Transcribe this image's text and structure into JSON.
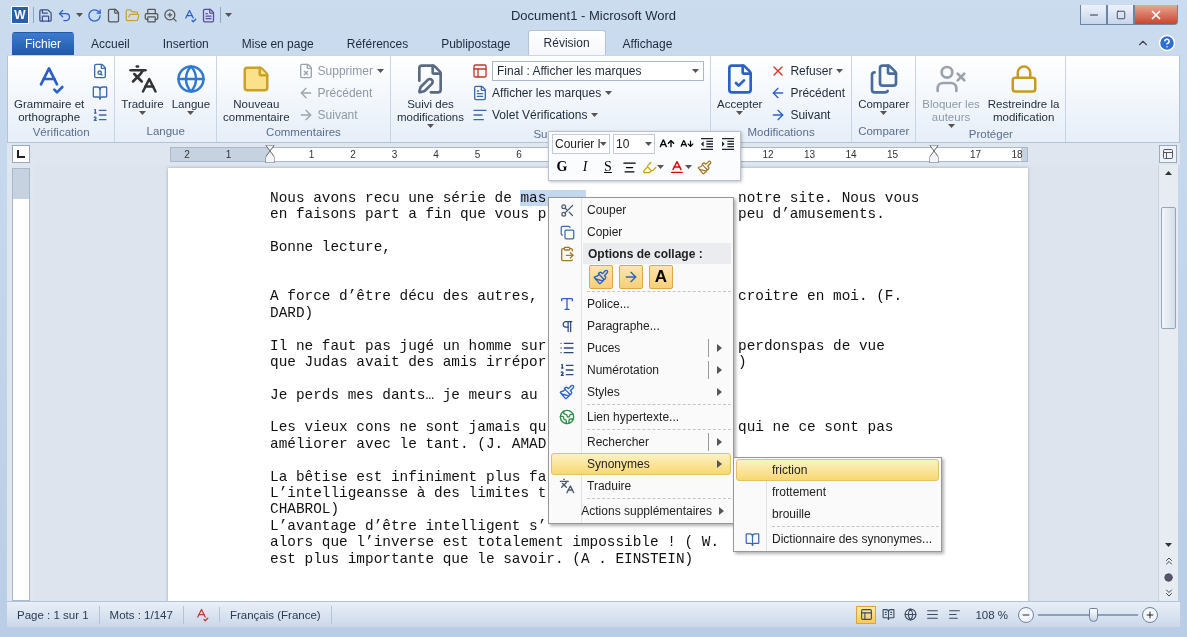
{
  "window": {
    "app_logo": "W",
    "title": "Document1 - Microsoft Word"
  },
  "tabs": [
    {
      "label": "Fichier",
      "kind": "file",
      "selected": false
    },
    {
      "label": "Accueil",
      "kind": "tab",
      "selected": false
    },
    {
      "label": "Insertion",
      "kind": "tab",
      "selected": false
    },
    {
      "label": "Mise en page",
      "kind": "tab",
      "selected": false
    },
    {
      "label": "Références",
      "kind": "tab",
      "selected": false
    },
    {
      "label": "Publipostage",
      "kind": "tab",
      "selected": false
    },
    {
      "label": "Révision",
      "kind": "tab",
      "selected": true
    },
    {
      "label": "Affichage",
      "kind": "tab",
      "selected": false
    }
  ],
  "ribbon": [
    {
      "label": "Vérification",
      "large": [
        {
          "lines": [
            "Grammaire et",
            "orthographe"
          ],
          "dropdown": false,
          "disabled": false
        }
      ],
      "small": [
        {
          "kind": "icon",
          "dropdown": false
        },
        {
          "kind": "icon",
          "dropdown": false
        },
        {
          "kind": "icon",
          "dropdown": false
        }
      ]
    },
    {
      "label": "Langue",
      "large": [
        {
          "lines": [
            "Traduire"
          ],
          "dropdown": true,
          "disabled": false
        },
        {
          "lines": [
            "Langue"
          ],
          "dropdown": true,
          "disabled": false
        }
      ]
    },
    {
      "label": "Commentaires",
      "large": [
        {
          "lines": [
            "Nouveau",
            "commentaire"
          ],
          "dropdown": false,
          "disabled": false
        }
      ],
      "small": [
        {
          "kind": "button",
          "label": "Supprimer",
          "dropdown": true,
          "disabled": true
        },
        {
          "kind": "button",
          "label": "Précédent",
          "dropdown": false,
          "disabled": true
        },
        {
          "kind": "button",
          "label": "Suivant",
          "dropdown": false,
          "disabled": true
        }
      ]
    },
    {
      "label": "Su",
      "large": [
        {
          "lines": [
            "Suivi des",
            "modifications"
          ],
          "dropdown": true,
          "disabled": false
        }
      ],
      "small": [
        {
          "kind": "combo",
          "label": "Final : Afficher les marques",
          "dropdown": true,
          "disabled": false
        },
        {
          "kind": "button",
          "label": "Afficher les marques",
          "dropdown": true,
          "disabled": false
        },
        {
          "kind": "button",
          "label": "Volet Vérifications",
          "dropdown": true,
          "disabled": false
        }
      ]
    },
    {
      "label": "Modifications",
      "large": [
        {
          "lines": [
            "Accepter"
          ],
          "dropdown": true,
          "disabled": false
        }
      ],
      "small": [
        {
          "kind": "button",
          "label": "Refuser",
          "dropdown": true,
          "disabled": false
        },
        {
          "kind": "button",
          "label": "Précédent",
          "dropdown": false,
          "disabled": false
        },
        {
          "kind": "button",
          "label": "Suivant",
          "dropdown": false,
          "disabled": false
        }
      ]
    },
    {
      "label": "Comparer",
      "large": [
        {
          "lines": [
            "Comparer"
          ],
          "dropdown": true,
          "disabled": false
        }
      ]
    },
    {
      "label": "Protéger",
      "large": [
        {
          "lines": [
            "Bloquer les",
            "auteurs"
          ],
          "dropdown": true,
          "disabled": true
        },
        {
          "lines": [
            "Restreindre la",
            "modification"
          ],
          "dropdown": false,
          "disabled": false
        }
      ]
    }
  ],
  "ruler": [
    {
      "kind": "number",
      "label": "2"
    },
    {
      "kind": "number",
      "label": "1"
    },
    {
      "kind": "indent"
    },
    {
      "kind": "number",
      "label": "1"
    },
    {
      "kind": "number",
      "label": "2"
    },
    {
      "kind": "number",
      "label": "3"
    },
    {
      "kind": "number",
      "label": "4"
    },
    {
      "kind": "number",
      "label": "5"
    },
    {
      "kind": "number",
      "label": "6"
    },
    {
      "kind": "covered"
    },
    {
      "kind": "covered"
    },
    {
      "kind": "covered"
    },
    {
      "kind": "covered"
    },
    {
      "kind": "covered"
    },
    {
      "kind": "number",
      "label": "12"
    },
    {
      "kind": "number",
      "label": "13"
    },
    {
      "kind": "number",
      "label": "14"
    },
    {
      "kind": "number",
      "label": "15"
    },
    {
      "kind": "indent"
    },
    {
      "kind": "number",
      "label": "17"
    },
    {
      "kind": "number",
      "label": "18"
    }
  ],
  "document": [
    {
      "kind": "text",
      "text": "Nous avons recu une série de ",
      "selection": "mas",
      "right": "notre site. Nous vous"
    },
    {
      "kind": "text",
      "text": "en faisons part a fin que vous p",
      "right": "peu d’amusements."
    },
    {
      "kind": "blank"
    },
    {
      "kind": "text",
      "text": "Bonne lecture,"
    },
    {
      "kind": "blank"
    },
    {
      "kind": "blank"
    },
    {
      "kind": "text",
      "text": "A force d’être décu des autres,",
      "right": "croitre en moi. (F."
    },
    {
      "kind": "text",
      "text": "DARD)"
    },
    {
      "kind": "blank"
    },
    {
      "kind": "text",
      "text": "Il ne faut pas jugé un homme sur",
      "right": "perdonspas de vue"
    },
    {
      "kind": "text",
      "text": "que Judas avait des amis irrépor",
      "right": ")"
    },
    {
      "kind": "blank"
    },
    {
      "kind": "text",
      "text": "Je perds mes dants… je meurs au"
    },
    {
      "kind": "blank"
    },
    {
      "kind": "text",
      "text": "Les vieux cons ne sont jamais qu",
      "right": "qui ne ce sont pas"
    },
    {
      "kind": "text",
      "text": "améliorer avec le tant. (J. AMAD"
    },
    {
      "kind": "blank"
    },
    {
      "kind": "text",
      "text": "La bêtise est infiniment plus fa"
    },
    {
      "kind": "text",
      "text": "L’intelligeansse à des limites t"
    },
    {
      "kind": "text",
      "text": "CHABROL)"
    },
    {
      "kind": "text",
      "text": "L’avantage d’être intelligent s’"
    },
    {
      "kind": "text",
      "text": "alors que l’inverse est totalement impossible ! ( W."
    },
    {
      "kind": "text",
      "text": "est plus importante que le savoir. (A . EINSTEIN)"
    }
  ],
  "mini_toolbar": {
    "font": "Courier l",
    "size": "10",
    "format_buttons": [
      "G",
      "I",
      "S"
    ]
  },
  "context_menu": [
    {
      "kind": "item",
      "label": "Couper",
      "submenu": false,
      "selected": false
    },
    {
      "kind": "item",
      "label": "Copier",
      "submenu": false,
      "selected": false
    },
    {
      "kind": "header",
      "label": "Options de collage :"
    },
    {
      "kind": "paste",
      "options": [
        {
          "kind": "format"
        },
        {
          "kind": "merge"
        },
        {
          "kind": "text",
          "label": "A"
        }
      ]
    },
    {
      "kind": "separator"
    },
    {
      "kind": "item",
      "label": "Police...",
      "submenu": false,
      "selected": false
    },
    {
      "kind": "item",
      "label": "Paragraphe...",
      "submenu": false,
      "selected": false
    },
    {
      "kind": "item",
      "label": "Puces",
      "submenu": true,
      "split": true,
      "selected": false
    },
    {
      "kind": "item",
      "label": "Numérotation",
      "submenu": true,
      "split": true,
      "selected": false
    },
    {
      "kind": "item",
      "label": "Styles",
      "submenu": true,
      "split": false,
      "selected": false
    },
    {
      "kind": "separator"
    },
    {
      "kind": "item",
      "label": "Lien hypertexte...",
      "submenu": false,
      "selected": false
    },
    {
      "kind": "separator"
    },
    {
      "kind": "item",
      "label": "Rechercher",
      "submenu": true,
      "split": true,
      "selected": false
    },
    {
      "kind": "item",
      "label": "Synonymes",
      "submenu": true,
      "split": false,
      "selected": true
    },
    {
      "kind": "item",
      "label": "Traduire",
      "submenu": false,
      "selected": false
    },
    {
      "kind": "separator"
    },
    {
      "kind": "item",
      "label": "Actions supplémentaires",
      "submenu": true,
      "split": false,
      "selected": false
    }
  ],
  "submenu": [
    {
      "kind": "item",
      "label": "friction",
      "selected": true
    },
    {
      "kind": "item",
      "label": "frottement",
      "selected": false
    },
    {
      "kind": "item",
      "label": "brouille",
      "selected": false
    },
    {
      "kind": "separator"
    },
    {
      "kind": "item",
      "label": "Dictionnaire des synonymes...",
      "selected": false
    }
  ],
  "status_bar": {
    "page": "Page : 1 sur 1",
    "words": "Mots : 1/147",
    "language": "Français (France)",
    "views": [
      {
        "selected": true
      },
      {
        "selected": false
      },
      {
        "selected": false
      },
      {
        "selected": false
      },
      {
        "selected": false
      }
    ],
    "zoom": "108 %",
    "zoom_slider": {
      "level": 0.55
    }
  }
}
